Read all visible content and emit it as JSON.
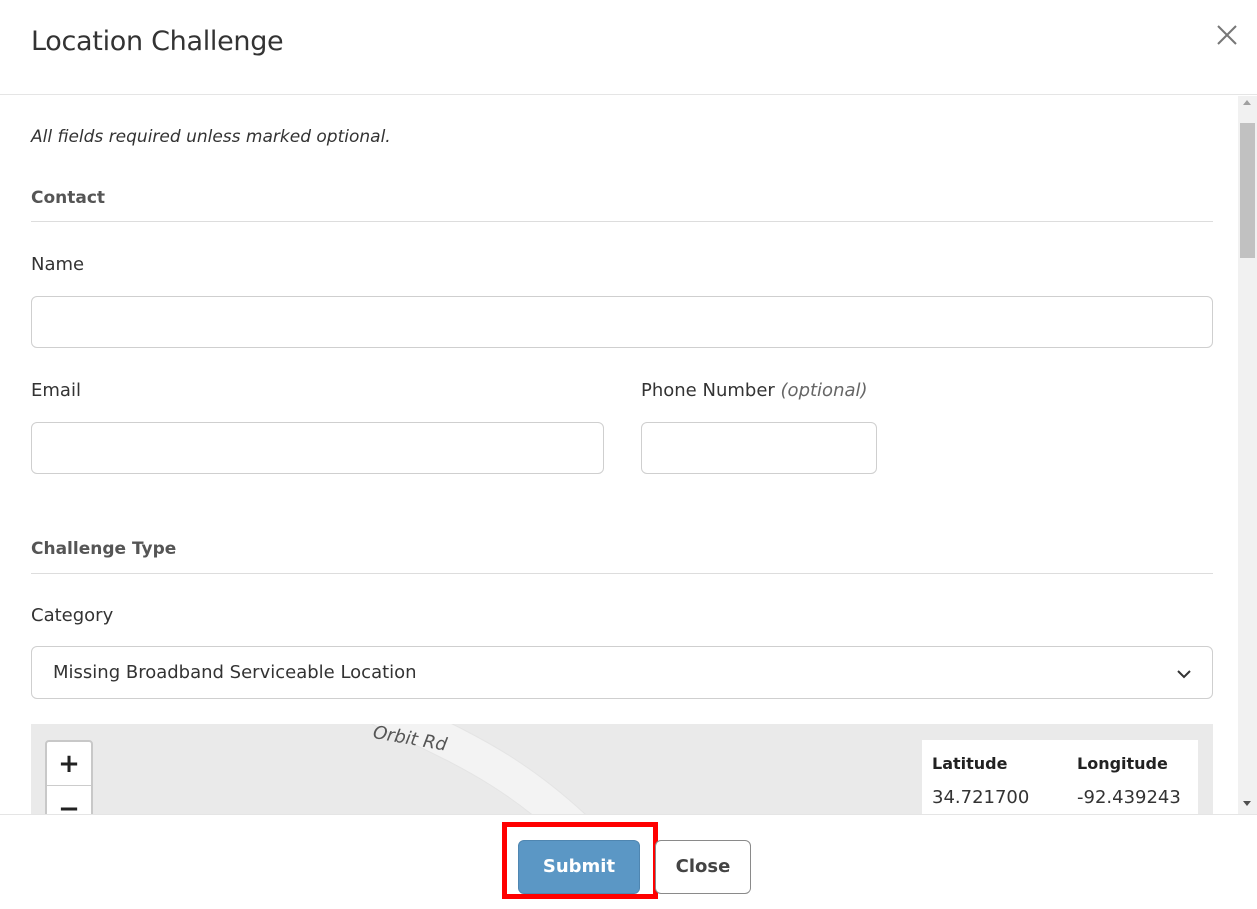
{
  "modal": {
    "title": "Location Challenge"
  },
  "form": {
    "required_note": "All fields required unless marked optional.",
    "contact_section": "Contact",
    "name_label": "Name",
    "name_value": "",
    "email_label": "Email",
    "email_value": "",
    "phone_label": "Phone Number",
    "phone_optional": "(optional)",
    "phone_value": "",
    "challenge_section": "Challenge Type",
    "category_label": "Category",
    "category_value": "Missing Broadband Serviceable Location"
  },
  "map": {
    "road_label": "Orbit Rd",
    "zoom_in": "+",
    "zoom_out": "−",
    "latitude_label": "Latitude",
    "longitude_label": "Longitude",
    "latitude_value": "34.721700",
    "longitude_value": "-92.439243"
  },
  "footer": {
    "submit_label": "Submit",
    "close_label": "Close"
  },
  "colors": {
    "submit_bg": "#5b97c5",
    "highlight": "#ff0000"
  },
  "icons": {
    "close": "close-icon",
    "chevron": "chevron-down-icon"
  }
}
